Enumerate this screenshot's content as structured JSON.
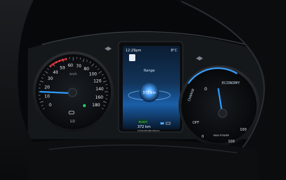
{
  "clock": {
    "time": "12:29pm",
    "temperature": "8°C"
  },
  "center_display": {
    "title": "Range",
    "range_value": "372 km",
    "ready_badge": "READY",
    "footer_range": "372 km",
    "footer_detail": "10 kW 28 kWh/100 km"
  },
  "speedometer": {
    "ticks": [
      "0",
      "10",
      "20",
      "30",
      "40",
      "50",
      "60",
      "70",
      "80",
      "100",
      "120",
      "140",
      "160",
      "180"
    ],
    "unit": "km/h",
    "battery_fraction": "1/2",
    "needle_value_kmh": 0
  },
  "power_meter": {
    "label_economy": "ECONOMY",
    "label_charge": "CHARGE",
    "label_off": "OFF",
    "label_max_power": "MAX POWER",
    "ticks": [
      "0",
      "0",
      "100",
      "100"
    ],
    "needle_value": 0
  },
  "colors": {
    "needle": "#2f9bff",
    "arc_glow": "#3aa0ff",
    "red_zone": "#d3242a",
    "green_indicator": "#29c46a",
    "screen_blue": "#1b5fa8"
  },
  "icons": [
    "cruise-icon",
    "headlight-icon",
    "charging-plug-icon",
    "battery-icon"
  ]
}
